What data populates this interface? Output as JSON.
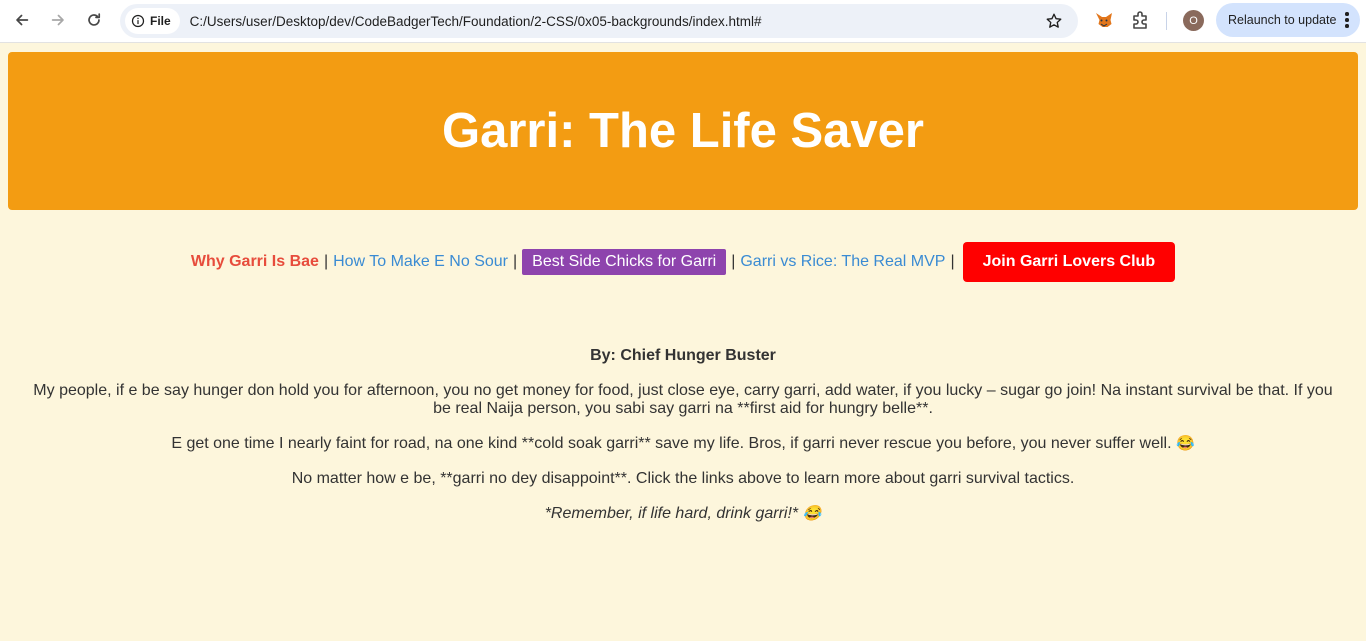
{
  "browser": {
    "file_chip": "File",
    "url": "C:/Users/user/Desktop/dev/CodeBadgerTech/Foundation/2-CSS/0x05-backgrounds/index.html#",
    "avatar_initial": "O",
    "relaunch_label": "Relaunch to update"
  },
  "header": {
    "title": "Garri: The Life Saver"
  },
  "nav": {
    "active": "Why Garri Is Bae",
    "sep": "|",
    "link1": "How To Make E No Sour",
    "pill": "Best Side Chicks for Garri",
    "link2": "Garri vs Rice: The Real MVP",
    "cta": "Join Garri Lovers Club"
  },
  "content": {
    "byline": "By: Chief Hunger Buster",
    "para1": "My people, if e be say hunger don hold you for afternoon, you no get money for food, just close eye, carry garri, add water, if you lucky – sugar go join! Na instant survival be that. If you be real Naija person, you sabi say garri na **first aid for hungry belle**.",
    "para2": "E get one time I nearly faint for road, na one kind **cold soak garri** save my life. Bros, if garri never rescue you before, you never suffer well.",
    "para3": "No matter how e be, **garri no dey disappoint**. Click the links above to learn more about garri survival tactics.",
    "para4": "*Remember, if life hard, drink garri!*",
    "emoji": "😂"
  },
  "colors": {
    "banner": "#f39c12",
    "page_bg": "#fdf6dc",
    "active_link": "#e74c3c",
    "link": "#3a8bd3",
    "pill": "#8e44ad",
    "cta": "#ff0000"
  }
}
